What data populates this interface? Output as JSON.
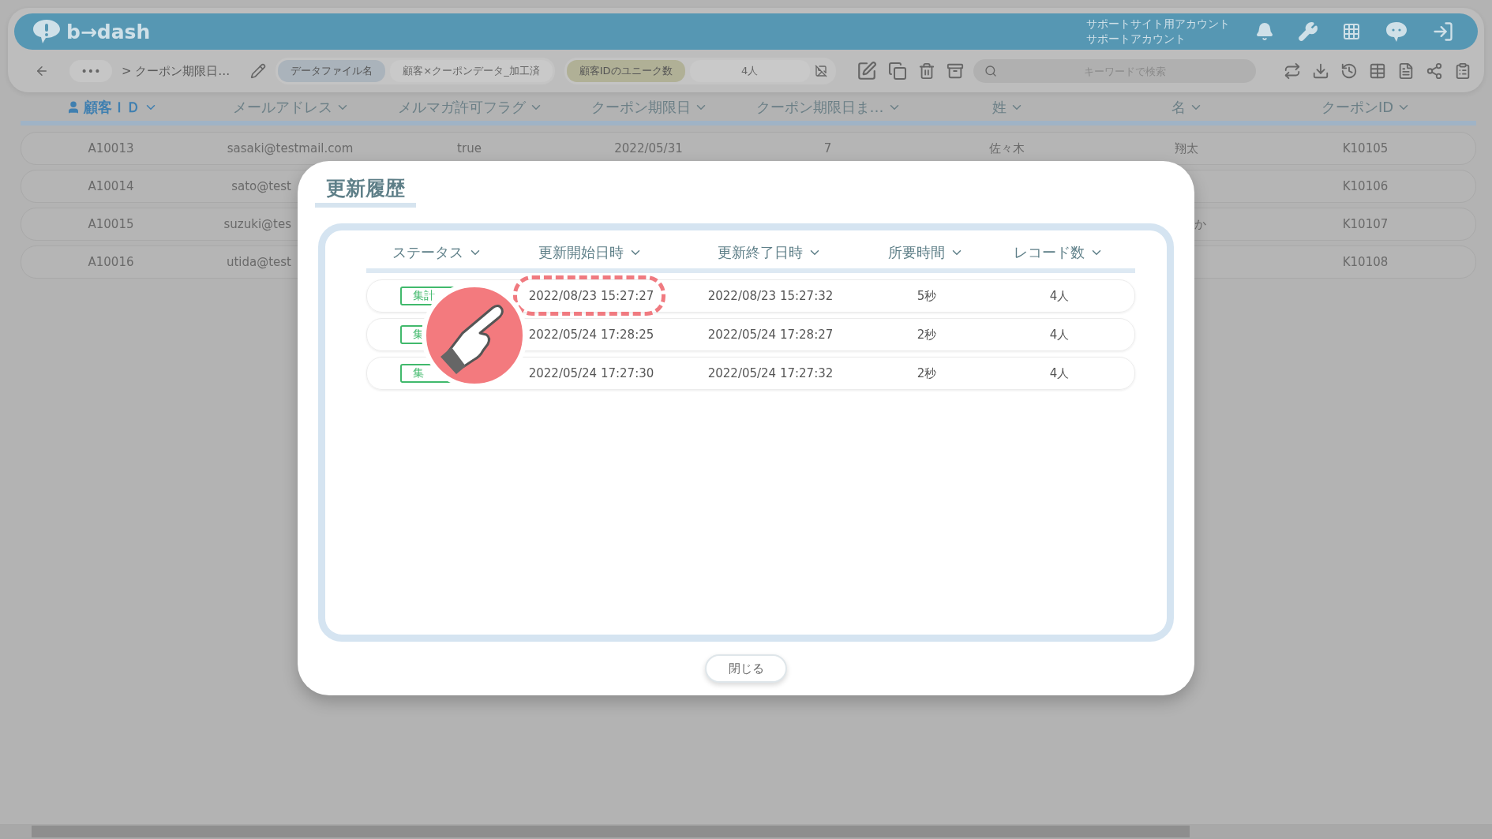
{
  "header": {
    "logo": "b→dash",
    "account_lines": [
      "サポートサイト用アカウント",
      "サポートアカウント"
    ]
  },
  "toolbar": {
    "more": "•••",
    "breadcrumb": "> クーポン期限日…",
    "chips": [
      {
        "kind": "file",
        "label": "データファイル名",
        "value": "顧客×クーポンデータ_加工済"
      },
      {
        "kind": "count",
        "label": "顧客IDのユニーク数",
        "value": "4人"
      }
    ],
    "search": {
      "placeholder": "キーワードで検索"
    }
  },
  "table": {
    "columns": [
      {
        "label": "顧客ＩＤ",
        "selected": true
      },
      {
        "label": "メールアドレス",
        "selected": false
      },
      {
        "label": "メルマガ許可フラグ",
        "selected": false
      },
      {
        "label": "クーポン期限日",
        "selected": false
      },
      {
        "label": "クーポン期限日ま…",
        "selected": false
      },
      {
        "label": "姓",
        "selected": false
      },
      {
        "label": "名",
        "selected": false
      },
      {
        "label": "クーポンID",
        "selected": false
      }
    ],
    "rows": [
      [
        "A10013",
        "sasaki@testmail.com",
        "true",
        "2022/05/31",
        "7",
        "佐々木",
        "翔太",
        "K10105"
      ],
      [
        "A10014",
        "sato@test",
        null,
        null,
        null,
        null,
        null,
        "K10106"
      ],
      [
        "A10015",
        "suzuki@tes",
        null,
        null,
        null,
        null,
        "か",
        "K10107"
      ],
      [
        "A10016",
        "utida@test",
        null,
        null,
        null,
        null,
        null,
        "K10108"
      ]
    ]
  },
  "dialog": {
    "title": "更新履歴",
    "columns": [
      "ステータス",
      "更新開始日時",
      "更新終了日時",
      "所要時間",
      "レコード数"
    ],
    "rows": [
      {
        "status": "集計",
        "start": "2022/08/23 15:27:27",
        "end": "2022/08/23 15:27:32",
        "duration": "5秒",
        "records": "4人",
        "highlighted": true
      },
      {
        "status": "集",
        "start": "2022/05/24 17:28:25",
        "end": "2022/05/24 17:28:27",
        "duration": "2秒",
        "records": "4人",
        "highlighted": false
      },
      {
        "status": "集",
        "start": "2022/05/24 17:27:30",
        "end": "2022/05/24 17:27:32",
        "duration": "2秒",
        "records": "4人",
        "highlighted": false
      }
    ],
    "close_button": "閉じる"
  }
}
